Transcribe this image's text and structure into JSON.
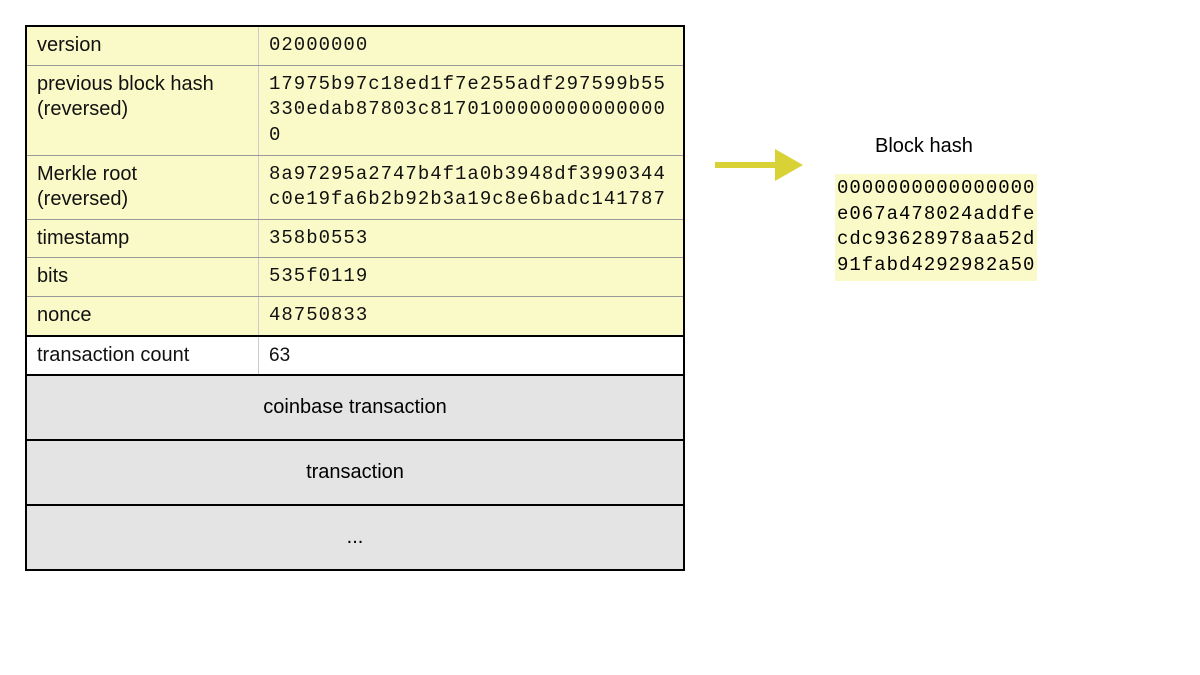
{
  "chart_data": {
    "type": "table",
    "title": "Bitcoin block structure → block hash",
    "header_fields": [
      {
        "label": "version",
        "value": "02000000"
      },
      {
        "label": "previous block hash (reversed)",
        "value": "17975b97c18ed1f7e255adf297599b55330edab87803c81701000000000000000"
      },
      {
        "label": "Merkle root (reversed)",
        "value": "8a97295a2747b4f1a0b3948df3990344c0e19fa6b2b92b3a19c8e6badc141787"
      },
      {
        "label": "timestamp",
        "value": "358b0553"
      },
      {
        "label": "bits",
        "value": "535f0119"
      },
      {
        "label": "nonce",
        "value": "48750833"
      }
    ],
    "transaction_count": {
      "label": "transaction count",
      "value": "63"
    },
    "transactions": [
      "coinbase transaction",
      "transaction",
      "..."
    ],
    "block_hash": {
      "title": "Block hash",
      "value": "0000000000000000e067a478024addfecdc93628978aa52d91fabd4292982a50"
    }
  },
  "rows": {
    "version": {
      "label": "version",
      "value": "02000000"
    },
    "prevhash": {
      "label": "previous block hash\n(reversed)",
      "value": "17975b97c18ed1f7e255adf297599b55\n330edab87803c81701000000000000000"
    },
    "merkle": {
      "label": "Merkle root\n(reversed)",
      "value": "8a97295a2747b4f1a0b3948df3990344\nc0e19fa6b2b92b3a19c8e6badc141787"
    },
    "timestamp": {
      "label": "timestamp",
      "value": "358b0553"
    },
    "bits": {
      "label": "bits",
      "value": "535f0119"
    },
    "nonce": {
      "label": "nonce",
      "value": "48750833"
    },
    "txcount": {
      "label": "transaction count",
      "value": "63"
    }
  },
  "txs": {
    "coinbase": "coinbase transaction",
    "tx": "transaction",
    "more": "..."
  },
  "hash": {
    "title": "Block hash",
    "lines": "0000000000000000\ne067a478024addfe\ncdc93628978aa52d\n91fabd4292982a50"
  }
}
